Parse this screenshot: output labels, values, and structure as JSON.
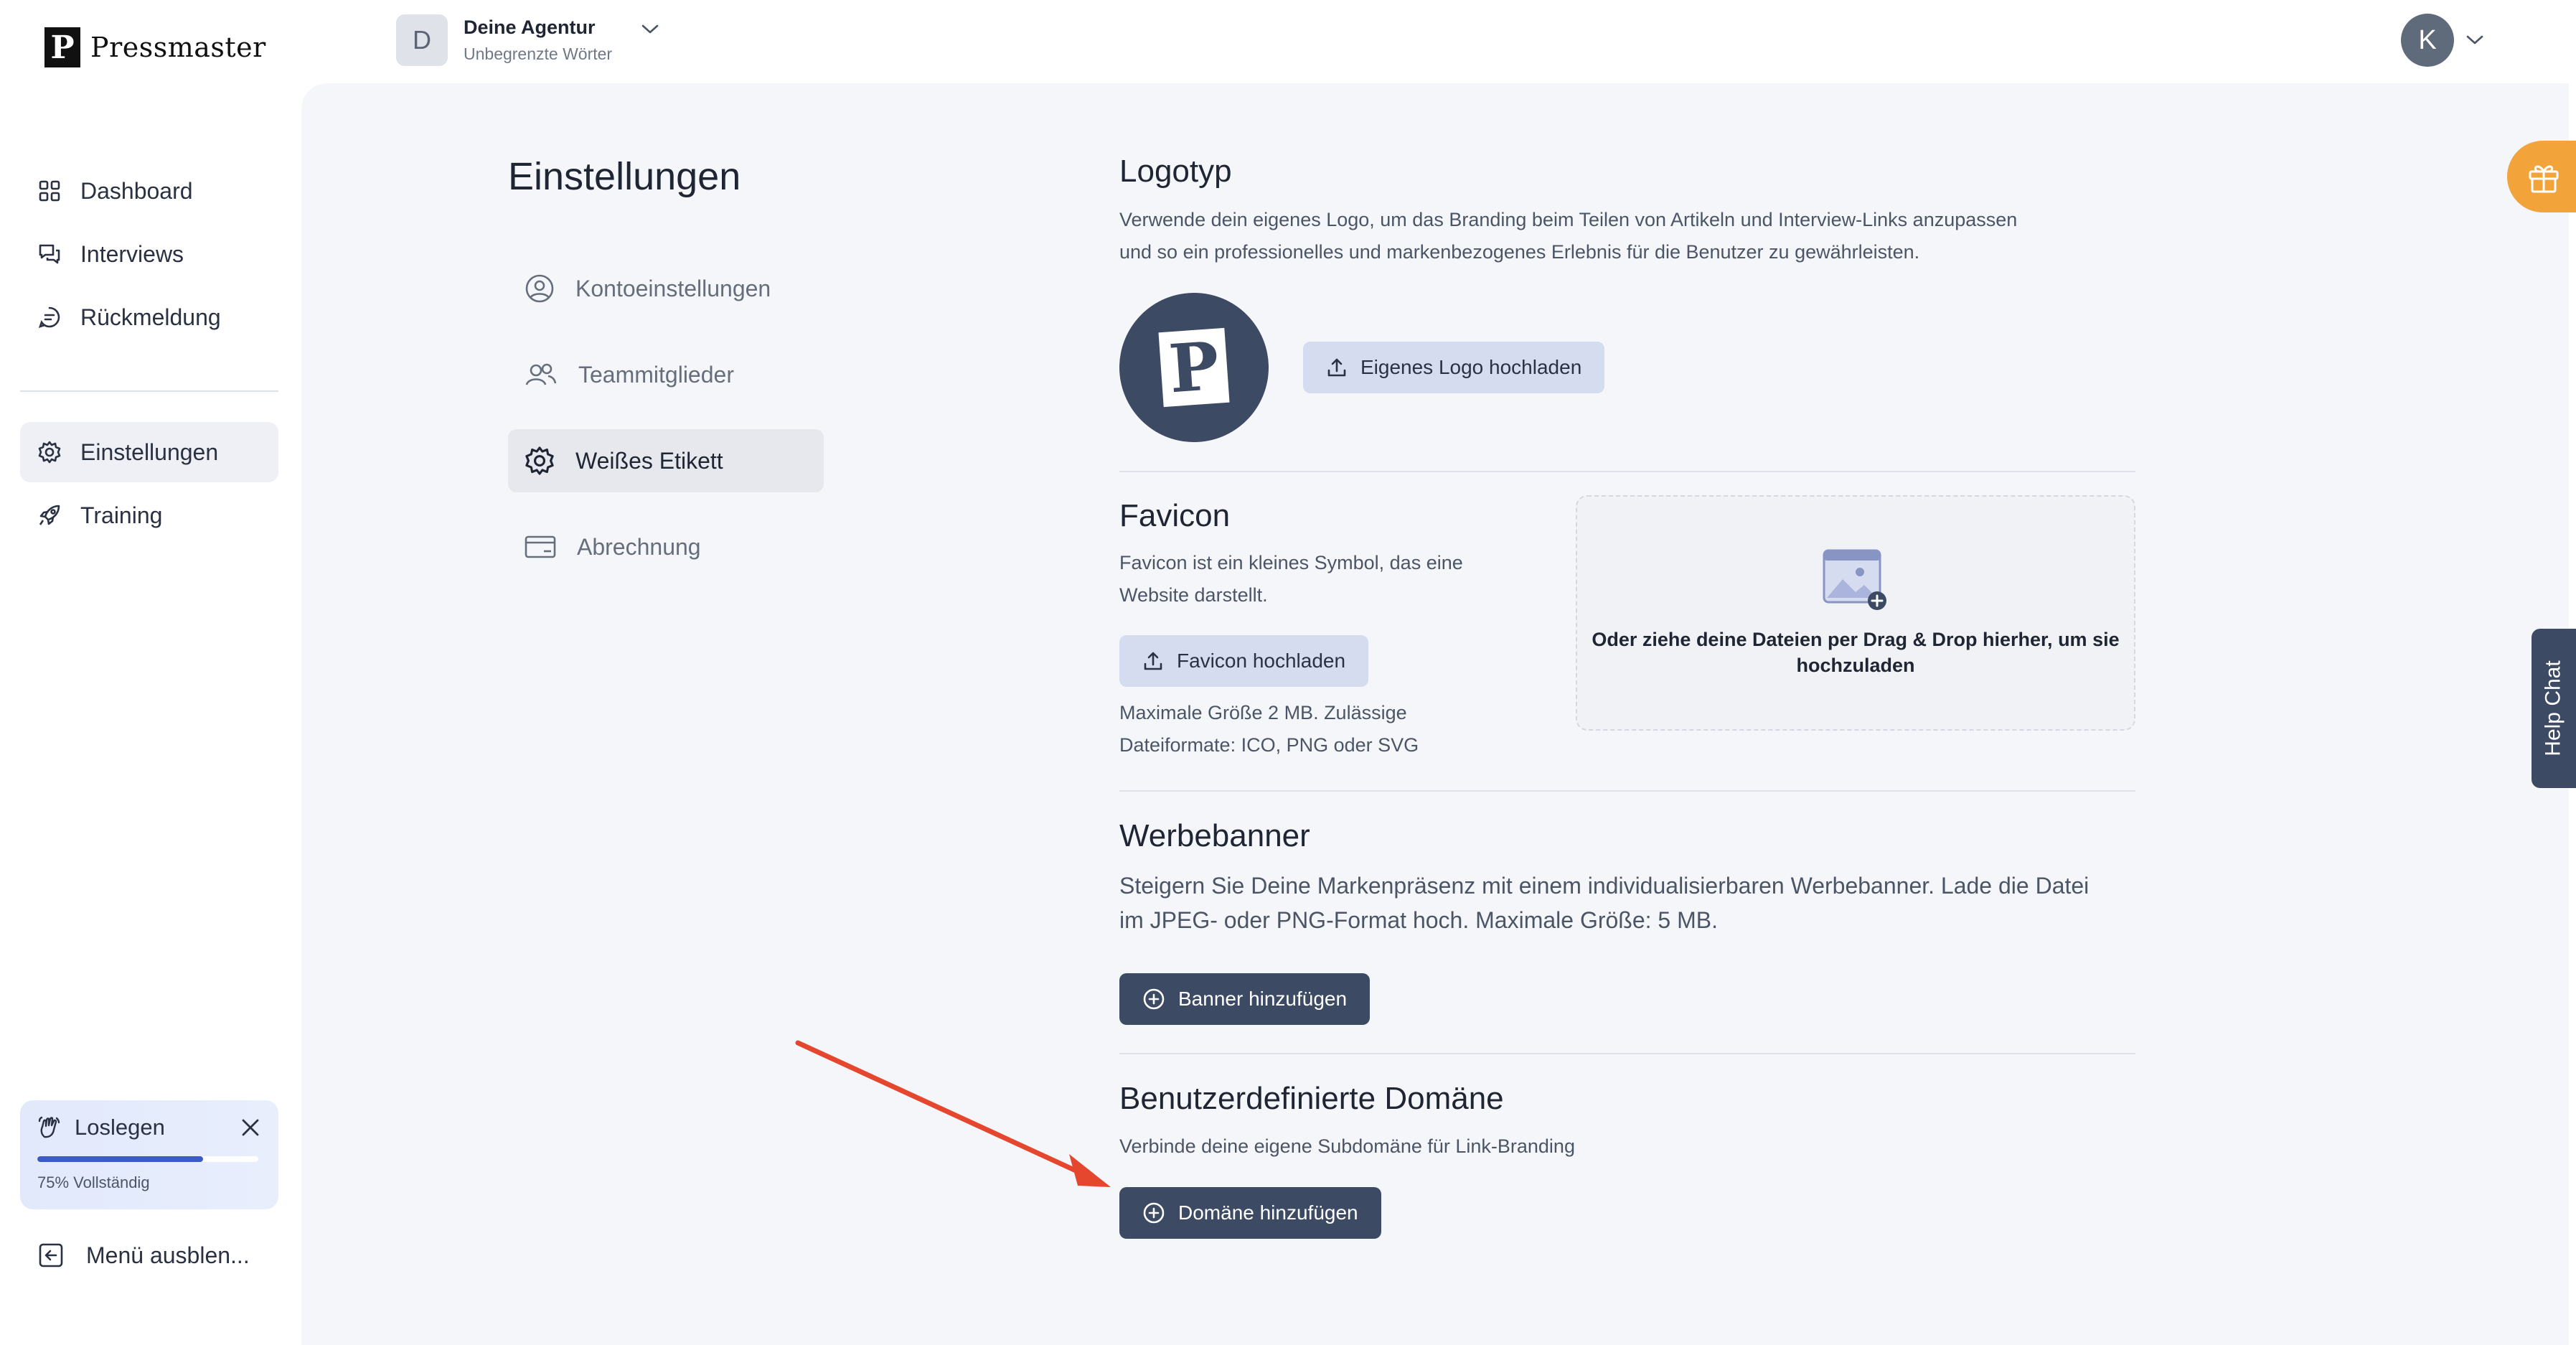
{
  "brand": {
    "name": "Pressmaster",
    "mark": "P"
  },
  "agency": {
    "initial": "D",
    "name": "Deine Agentur",
    "subtitle": "Unbegrenzte Wörter"
  },
  "user": {
    "initial": "K"
  },
  "nav": {
    "items": [
      {
        "label": "Dashboard",
        "icon": "grid-icon"
      },
      {
        "label": "Interviews",
        "icon": "chat-icon"
      },
      {
        "label": "Rückmeldung",
        "icon": "feedback-icon"
      },
      {
        "label": "Einstellungen",
        "icon": "gear-icon",
        "active": true
      },
      {
        "label": "Training",
        "icon": "rocket-icon"
      }
    ],
    "collapse_label": "Menü ausblen..."
  },
  "onboarding": {
    "title": "Loslegen",
    "progress_label": "75% Vollständig",
    "progress": 0.75
  },
  "settings": {
    "title": "Einstellungen",
    "menu": [
      {
        "label": "Kontoeinstellungen",
        "icon": "user-circle-icon"
      },
      {
        "label": "Teammitglieder",
        "icon": "users-icon"
      },
      {
        "label": "Weißes Etikett",
        "icon": "gear-icon",
        "active": true
      },
      {
        "label": "Abrechnung",
        "icon": "credit-card-icon"
      }
    ]
  },
  "logotyp": {
    "title": "Logotyp",
    "desc_line1": "Verwende dein eigenes Logo, um das Branding beim Teilen von Artikeln und Interview-Links anzupassen",
    "desc_line2": "und so ein professionelles und markenbezogenes Erlebnis für die Benutzer zu gewährleisten.",
    "logo_mark": "P",
    "upload_label": "Eigenes Logo hochladen"
  },
  "favicon": {
    "title": "Favicon",
    "desc_line1": "Favicon ist ein kleines Symbol, das eine",
    "desc_line2": "Website darstellt.",
    "upload_label": "Favicon hochladen",
    "hint_line1": "Maximale Größe 2 MB. Zulässige",
    "hint_line2": "Dateiformate: ICO, PNG oder SVG",
    "dropzone_text": "Oder ziehe deine Dateien per Drag & Drop hierher, um sie hochzuladen"
  },
  "banner": {
    "title": "Werbebanner",
    "desc_line1": "Steigern Sie Deine Markenpräsenz mit einem individualisierbaren Werbebanner. Lade die Datei",
    "desc_line2": "im JPEG- oder PNG-Format hoch. Maximale Größe: 5 MB.",
    "button_label": "Banner hinzufügen"
  },
  "domain": {
    "title": "Benutzerdefinierte Domäne",
    "desc": "Verbinde deine eigene Subdomäne für Link-Branding",
    "button_label": "Domäne hinzufügen"
  },
  "help_chat": {
    "label": "Help Chat"
  },
  "colors": {
    "accent_dark": "#3d4a63",
    "accent_light": "#d6dcf0",
    "gift": "#f2a33a",
    "annotation_arrow": "#e5462e"
  }
}
